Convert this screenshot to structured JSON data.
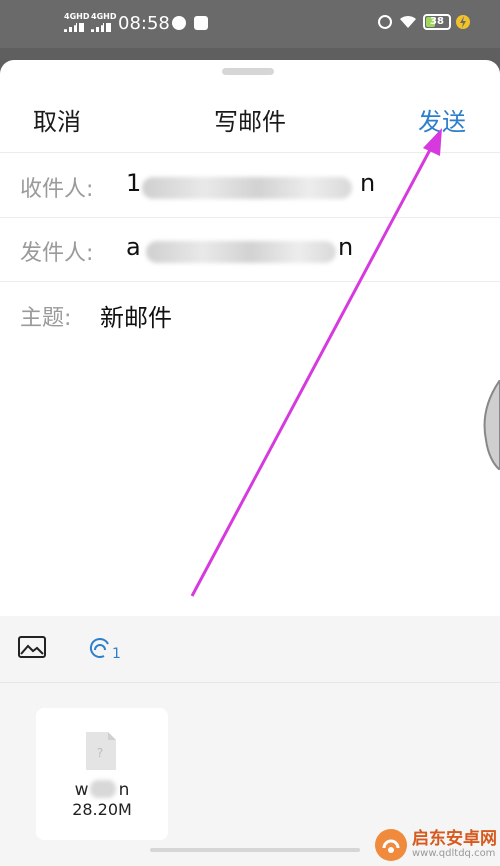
{
  "status_bar": {
    "signal1_label": "4GHD",
    "signal2_label": "4GHD",
    "time": "08:58",
    "battery_level": "38",
    "battery_fraction": 0.38,
    "battery_color": "#9fd65d",
    "icons": [
      "compass-icon",
      "telegram-icon",
      "alarm-icon",
      "wifi-icon",
      "battery-icon",
      "charging-bolt-icon"
    ]
  },
  "nav": {
    "cancel": "取消",
    "title": "写邮件",
    "send": "发送",
    "send_color": "#2d7ecb"
  },
  "fields": {
    "to_label": "收件人:",
    "to_value": "1",
    "to_value_tail": "n",
    "from_label": "发件人:",
    "from_value": "a",
    "from_value_tail": "n",
    "subject_label": "主题:",
    "subject_value": "新邮件"
  },
  "toolbar": {
    "image_icon": "image-icon",
    "attachment_icon": "attachment-count-icon",
    "attachment_count": "1",
    "attachment_color": "#2d7ecb"
  },
  "attachment": {
    "name": "w",
    "name_tail": "n",
    "size": "28.20M",
    "icon": "unknown-file-icon"
  },
  "annotation": {
    "arrow_color": "#d63adf"
  },
  "watermark": {
    "title": "启东安卓网",
    "url": "www.qdltdq.com"
  }
}
